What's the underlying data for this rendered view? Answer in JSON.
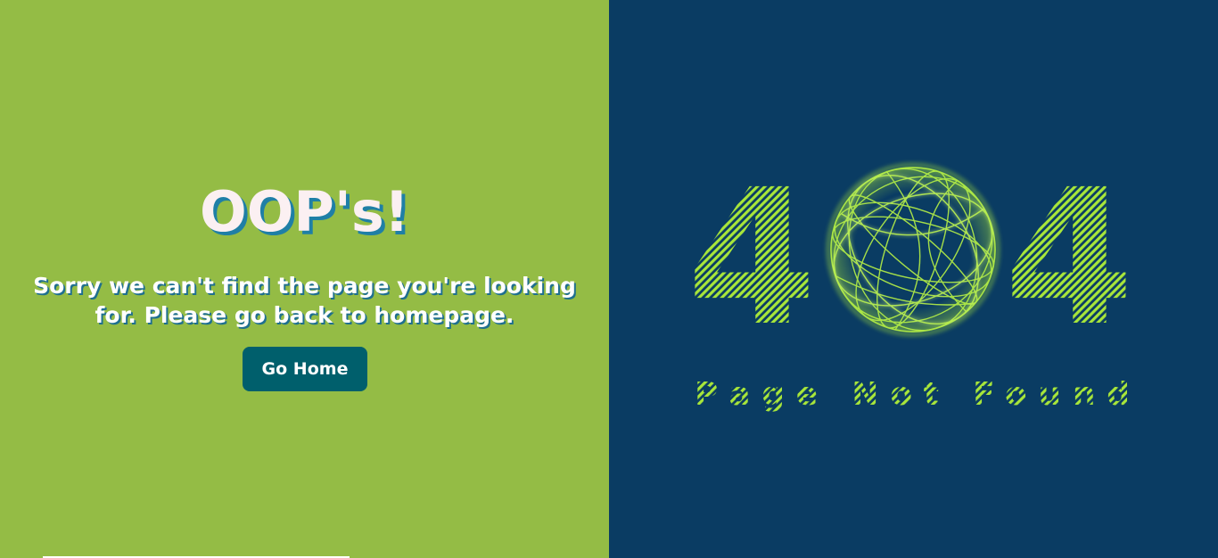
{
  "left": {
    "headline": "OOP's!",
    "message": "Sorry we can't find the page you're looking for. Please go back to homepage.",
    "button_label": "Go Home"
  },
  "right": {
    "digit_left": "4",
    "digit_right": "4",
    "subtitle": "Page Not Found"
  },
  "colors": {
    "left_bg": "#94bc45",
    "right_bg": "#0a3c63",
    "button_bg": "#005f6c",
    "accent_green": "#a8e63a"
  },
  "icons": {
    "globe": "wireframe-globe-icon"
  }
}
